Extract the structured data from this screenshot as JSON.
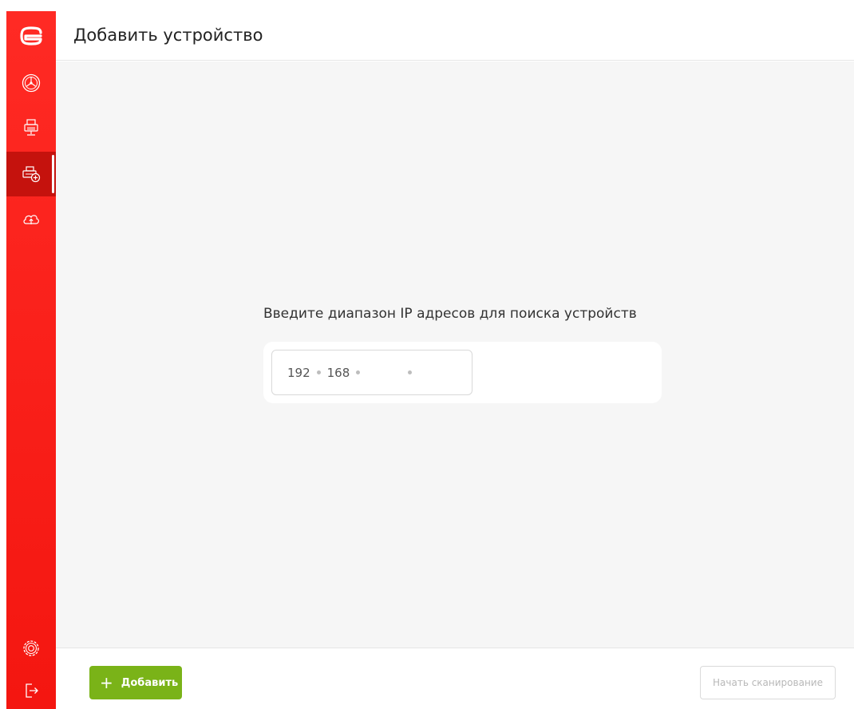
{
  "header": {
    "title": "Добавить устройство"
  },
  "sidebar": {
    "items": [
      {
        "icon": "dashboard-icon",
        "active": false
      },
      {
        "icon": "printer-network-icon",
        "active": false
      },
      {
        "icon": "add-printer-icon",
        "active": true
      },
      {
        "icon": "cloud-upload-icon",
        "active": false
      }
    ],
    "bottom_items": [
      {
        "icon": "settings-gear-icon"
      },
      {
        "icon": "logout-icon"
      }
    ]
  },
  "main": {
    "prompt": "Введите диапазон IP адресов для поиска устройств",
    "ip": {
      "octet1": "192",
      "octet2": "168",
      "octet3": "",
      "octet4": ""
    }
  },
  "footer": {
    "add_label": "Добавить",
    "scan_label": "Начать сканирование"
  },
  "colors": {
    "sidebar": "#f41610",
    "sidebar_active": "#c5120d",
    "accent_green": "#7ab318",
    "background": "#f6f6f6"
  }
}
